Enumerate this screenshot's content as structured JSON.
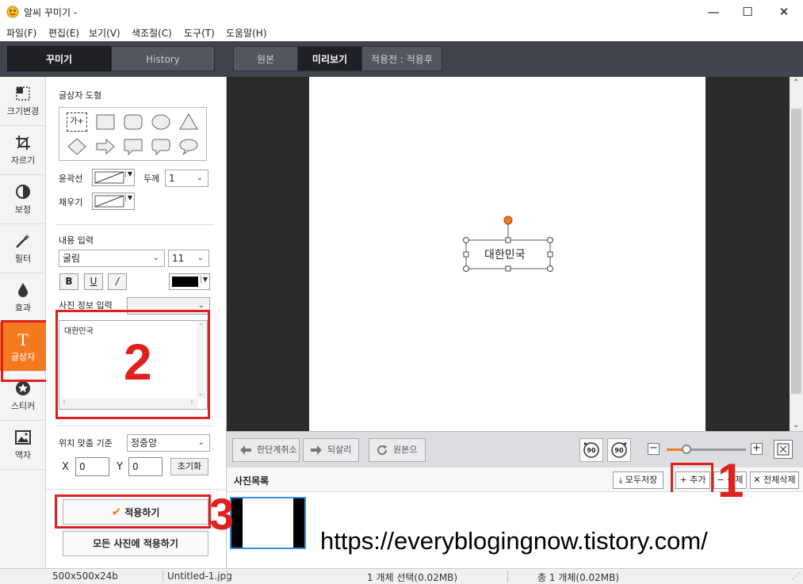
{
  "window": {
    "title": "알씨 꾸미기 -"
  },
  "menu": [
    "파일(F)",
    "편집(E)",
    "보기(V)",
    "색조절(C)",
    "도구(T)",
    "도움말(H)"
  ],
  "left_tabs": {
    "active": "꾸미기",
    "inactive": "History"
  },
  "view_tabs": [
    "원본",
    "미리보기",
    "적용전 : 적용후"
  ],
  "sidebar": [
    {
      "label": "크기변경",
      "icon": "resize-icon"
    },
    {
      "label": "자르기",
      "icon": "crop-icon"
    },
    {
      "label": "보정",
      "icon": "adjust-icon"
    },
    {
      "label": "필터",
      "icon": "filter-wand-icon"
    },
    {
      "label": "효과",
      "icon": "drop-icon"
    },
    {
      "label": "글상자",
      "icon": "text-t-icon",
      "active": true
    },
    {
      "label": "스티커",
      "icon": "sticker-star-icon"
    },
    {
      "label": "액자",
      "icon": "frame-picture-icon"
    }
  ],
  "panel": {
    "shape_label": "글상자 도형",
    "text_shape_label": "가+",
    "outline_label": "윤곽선",
    "thickness_label": "두께",
    "thickness_value": "1",
    "fill_label": "채우기",
    "content_label": "내용 입력",
    "font_value": "굴림",
    "font_size_value": "11",
    "bold": "B",
    "underline": "U",
    "italic": "/",
    "text_color": "#000000",
    "photo_info_label": "사진 정보 입력",
    "text_content": "대한민국",
    "align_label": "위치 맞춤 기준",
    "align_value": "정중앙",
    "x_label": "X",
    "x_value": "0",
    "y_label": "Y",
    "y_value": "0",
    "reset_label": "초기화",
    "apply_label": "적용하기",
    "apply_all_label": "모든 사진에 적용하기"
  },
  "canvas": {
    "textbox_text": "대한민국"
  },
  "actions": {
    "undo": "한단계취소",
    "redo": "되살리기",
    "original": "원본으로",
    "rotate_left": "90",
    "rotate_right": "90",
    "zoom_level": 0.25
  },
  "photo_list": {
    "title": "사진목록",
    "save_all": "모두저장",
    "add": "+ 추가",
    "delete": "− 삭제",
    "delete_all": "✕ 전체삭제"
  },
  "watermark": "https://everyblogingnow.tistory.com/",
  "annotations": [
    "1",
    "2",
    "3"
  ],
  "status": {
    "dimensions": "500x500x24b",
    "filename": "Untitled-1.jpg",
    "selection": "1 개체 선택(0.02MB)",
    "total": "총 1 개체(0.02MB)"
  }
}
